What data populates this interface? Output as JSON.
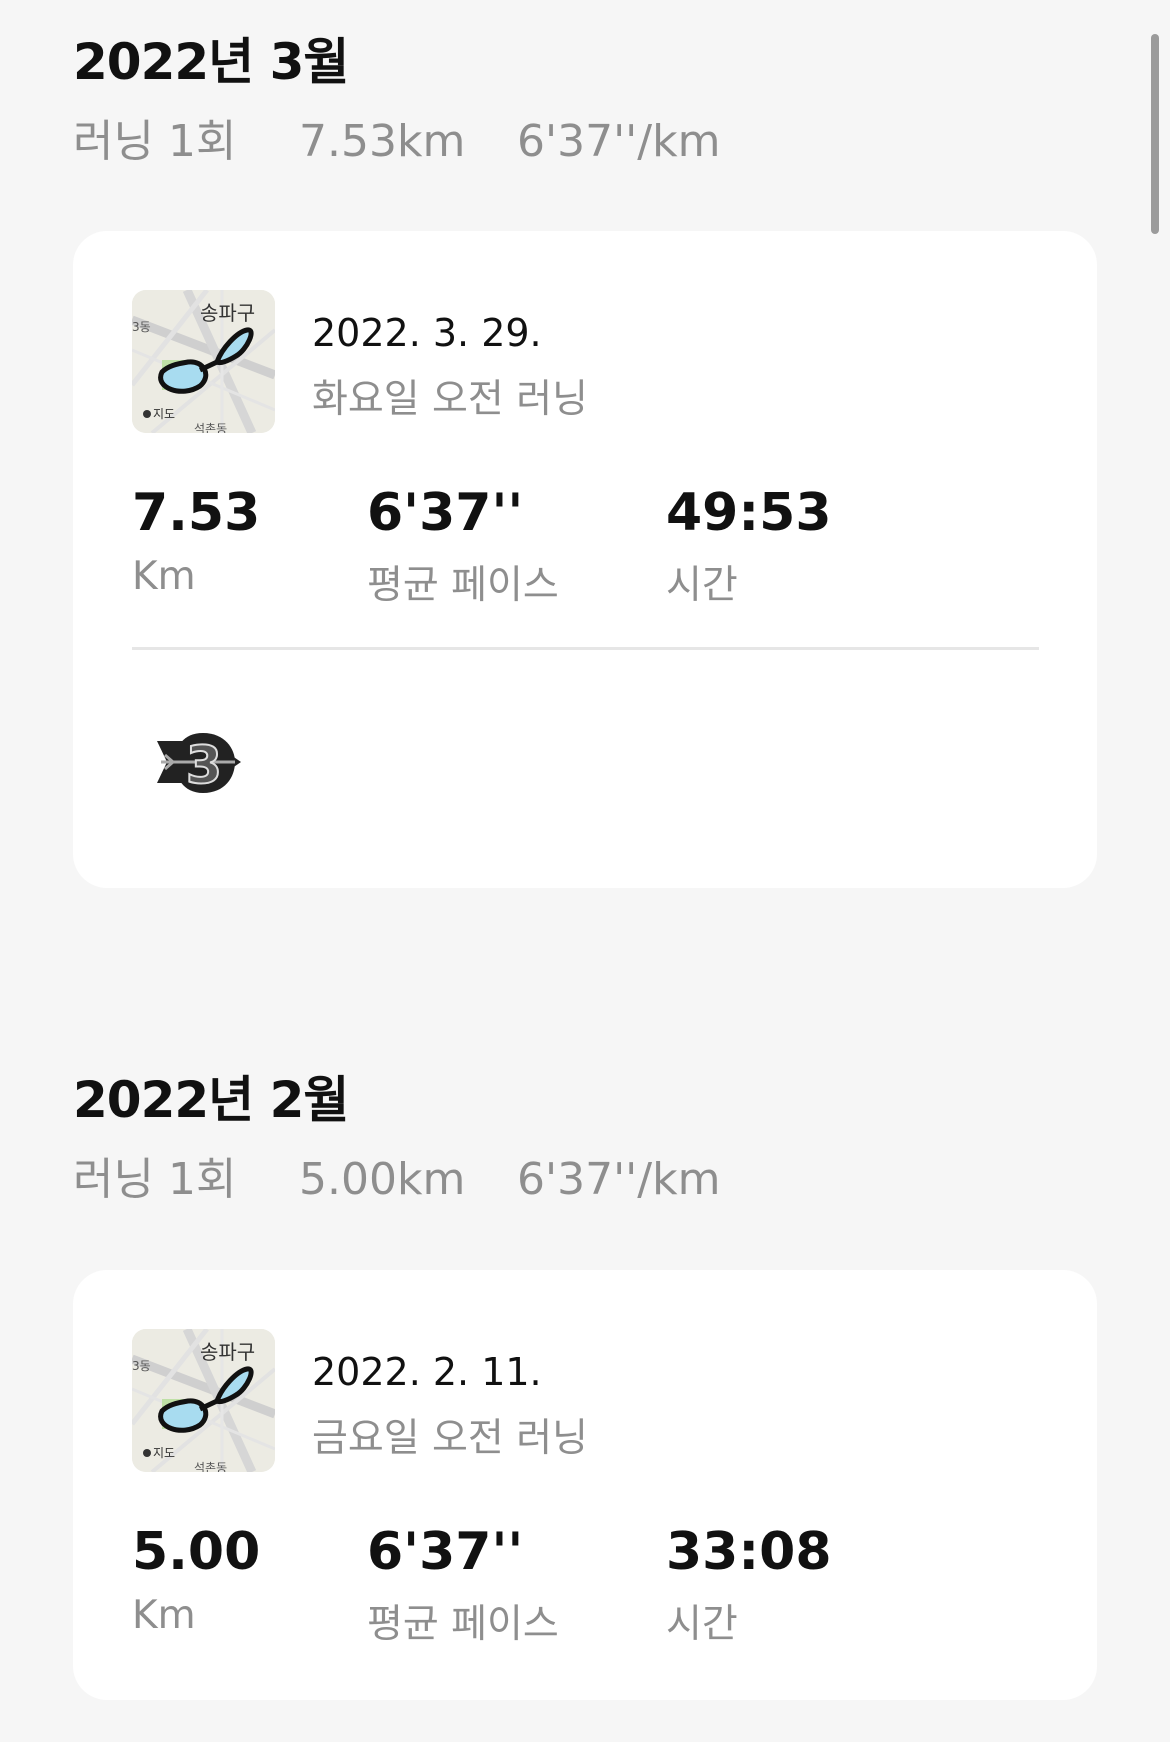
{
  "months": [
    {
      "title": "2022년 3월",
      "summary": {
        "count": "러닝 1회",
        "distance": "7.53km",
        "pace": "6'37''/km"
      },
      "run": {
        "map_labels": {
          "district": "송파구",
          "left": "3동",
          "bottom": "석촌동",
          "maps_brand": "지도"
        },
        "date": "2022. 3. 29.",
        "name": "화요일 오전 러닝",
        "distance_value": "7.53",
        "distance_label": "Km",
        "pace_value": "6'37''",
        "pace_label": "평균 페이스",
        "time_value": "49:53",
        "time_label": "시간",
        "badge": "3"
      }
    },
    {
      "title": "2022년 2월",
      "summary": {
        "count": "러닝 1회",
        "distance": "5.00km",
        "pace": "6'37''/km"
      },
      "run": {
        "map_labels": {
          "district": "송파구",
          "left": "3동",
          "bottom": "석촌동",
          "maps_brand": "지도"
        },
        "date": "2022. 2. 11.",
        "name": "금요일 오전 러닝",
        "distance_value": "5.00",
        "distance_label": "Km",
        "pace_value": "6'37''",
        "pace_label": "평균 페이스",
        "time_value": "33:08",
        "time_label": "시간"
      }
    }
  ],
  "icons": {
    "route_map": "route-map-thumbnail",
    "achievement": "achievement-badge-icon",
    "apple": "apple-logo-icon"
  },
  "colors": {
    "background": "#f6f6f6",
    "card": "#ffffff",
    "primary_text": "#111111",
    "secondary_text": "#8e8e8e",
    "route_fill": "#a8dcf0"
  }
}
